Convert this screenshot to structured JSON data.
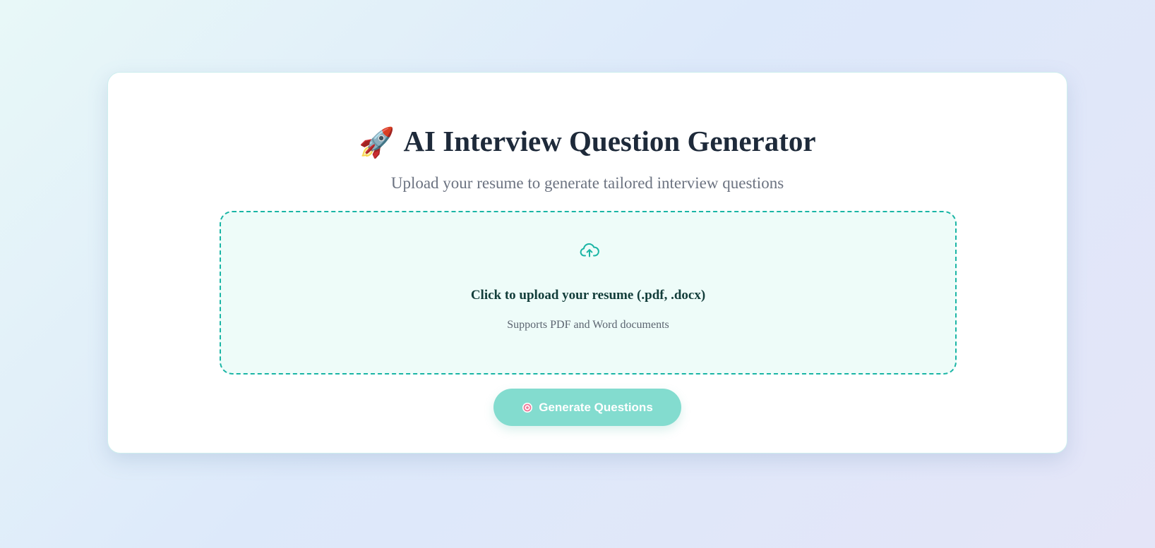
{
  "header": {
    "title_icon": "rocket-icon",
    "title_emoji": "🚀",
    "title": "AI Interview Question Generator",
    "subtitle": "Upload your resume to generate tailored interview questions"
  },
  "upload": {
    "icon": "cloud-upload-icon",
    "label": "Click to upload your resume (.pdf, .docx)",
    "hint": "Supports PDF and Word documents"
  },
  "generate_button": {
    "icon": "target-icon",
    "label": "Generate Questions",
    "state": "disabled"
  },
  "colors": {
    "accent": "#1ab5a5",
    "button_disabled": "#83dccf",
    "title_text": "#1e2a3a",
    "muted_text": "#6b7280"
  }
}
